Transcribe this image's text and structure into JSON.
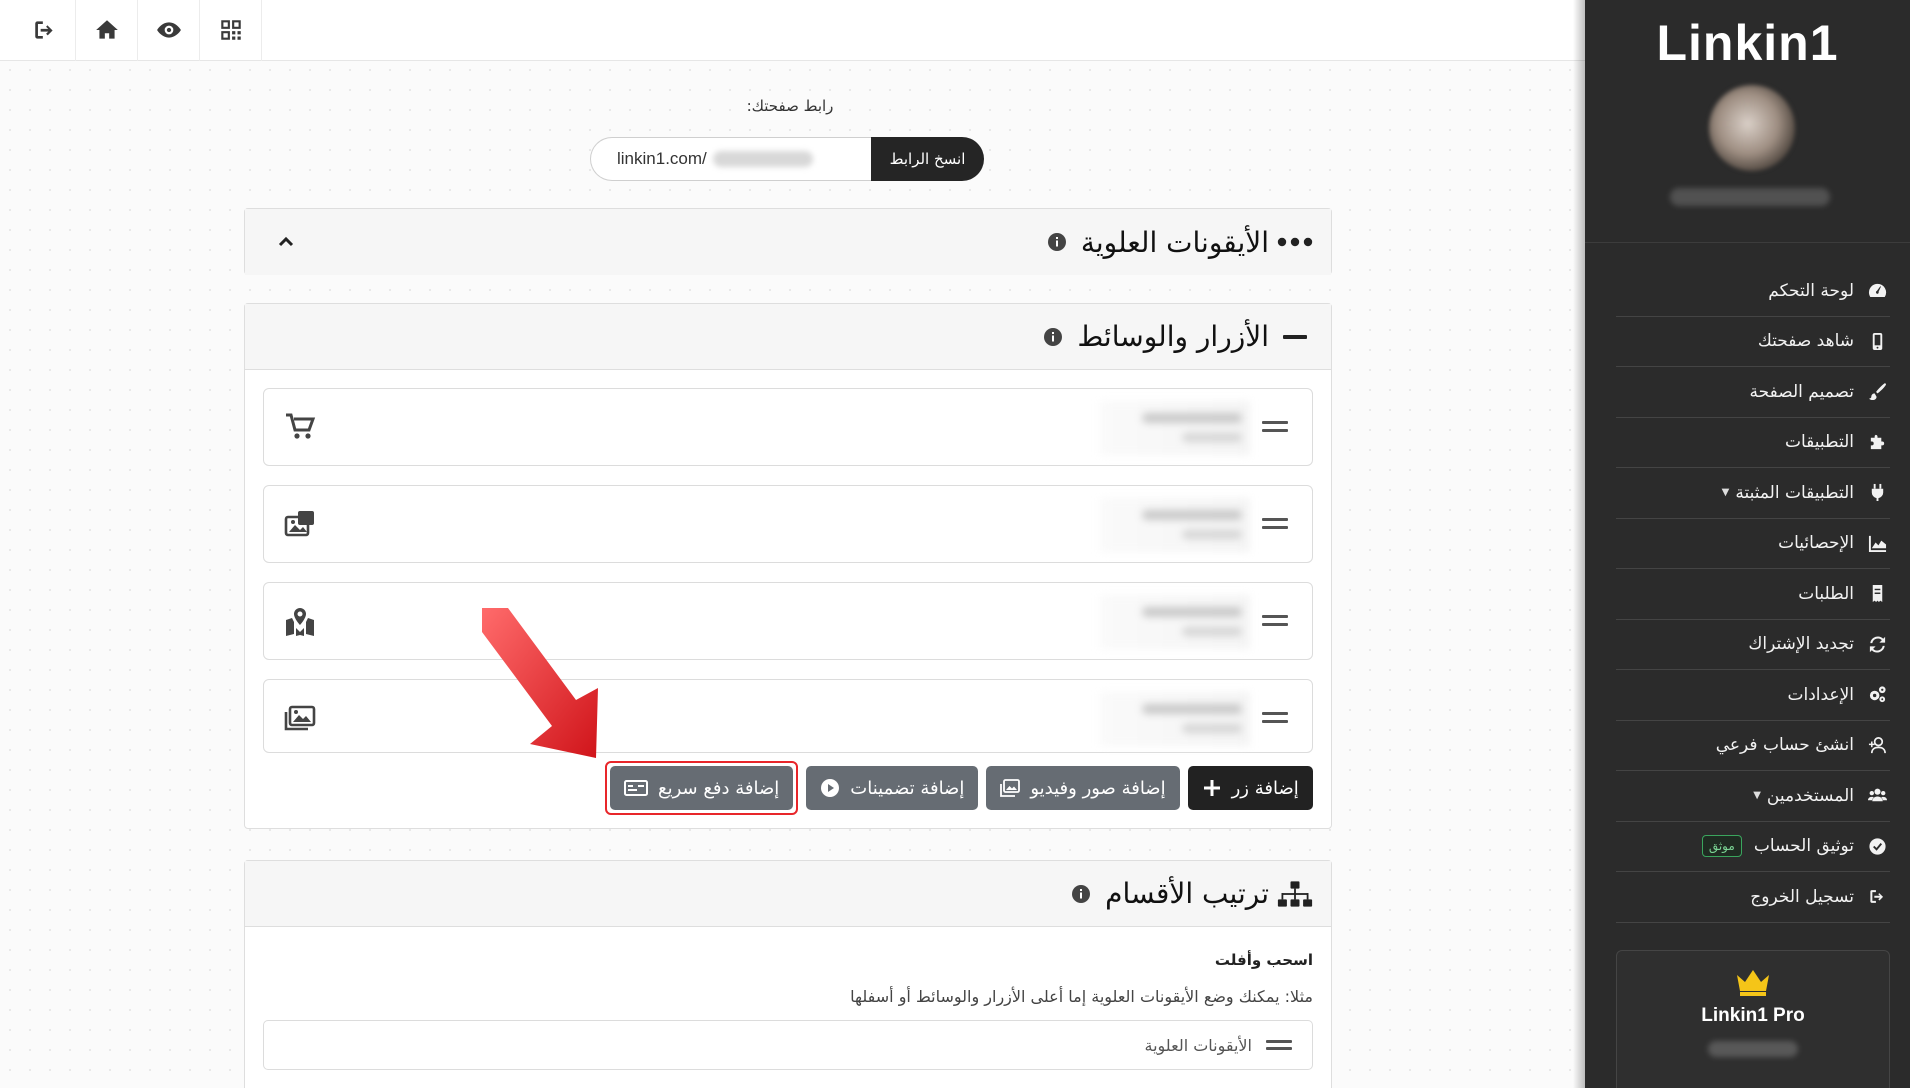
{
  "topbar": {
    "buttons": [
      {
        "icon": "sign-out-icon"
      },
      {
        "icon": "home-icon"
      },
      {
        "icon": "eye-icon"
      },
      {
        "icon": "qr-code-icon"
      }
    ]
  },
  "page_link": {
    "label": "رابط صفحتك:",
    "url_prefix": "linkin1.com/",
    "copy_button": "انسخ الرابط"
  },
  "panels": {
    "top_icons": {
      "title": "الأيقونات العلوية"
    },
    "buttons_media": {
      "title": "الأزرار والوسائط",
      "rows": [
        {
          "icon": "shopping-cart-icon"
        },
        {
          "icon": "photo-video-icon"
        },
        {
          "icon": "map-marked-icon"
        },
        {
          "icon": "images-icon"
        }
      ],
      "actions": {
        "add_button": "إضافة زر",
        "add_media": "إضافة صور وفيديو",
        "add_embeds": "إضافة تضمينات",
        "add_quick_pay": "إضافة دفع سريع"
      }
    },
    "sections_order": {
      "title": "ترتيب الأقسام",
      "drag_drop_title": "اسحب وأفلت",
      "description": "مثلا: يمكنك وضع الأيقونات العلوية إما أعلى الأزرار والوسائط أو أسفلها",
      "items": [
        "الأيقونات العلوية"
      ]
    }
  },
  "sidebar": {
    "brand": "Linkin1",
    "menu": [
      {
        "label": "لوحة التحكم",
        "icon": "tachometer-icon"
      },
      {
        "label": "شاهد صفحتك",
        "icon": "mobile-icon"
      },
      {
        "label": "تصميم الصفحة",
        "icon": "paint-brush-icon"
      },
      {
        "label": "التطبيقات",
        "icon": "puzzle-piece-icon"
      },
      {
        "label": "التطبيقات المثبتة",
        "icon": "plug-icon"
      },
      {
        "label": "الإحصائيات",
        "icon": "chart-area-icon"
      },
      {
        "label": "الطلبات",
        "icon": "receipt-icon"
      },
      {
        "label": "تجديد الإشتراك",
        "icon": "sync-icon"
      },
      {
        "label": "الإعدادات",
        "icon": "cogs-icon"
      },
      {
        "label": "انشئ حساب فرعي",
        "icon": "user-plus-icon"
      },
      {
        "label": "المستخدمين",
        "icon": "users-icon"
      },
      {
        "label": "توثيق الحساب",
        "icon": "check-circle-icon",
        "badge": "موثق"
      },
      {
        "label": "تسجيل الخروج",
        "icon": "sign-out-icon"
      }
    ],
    "pro_card": {
      "title": "Linkin1 Pro",
      "icon": "crown-icon"
    }
  },
  "colors": {
    "sidebar_bg": "#2b2b2b",
    "dark_button": "#222222",
    "gray_button": "#666c73",
    "highlight": "#e8262a",
    "crown": "#f5c518",
    "verified_badge": "#3aa55d"
  }
}
